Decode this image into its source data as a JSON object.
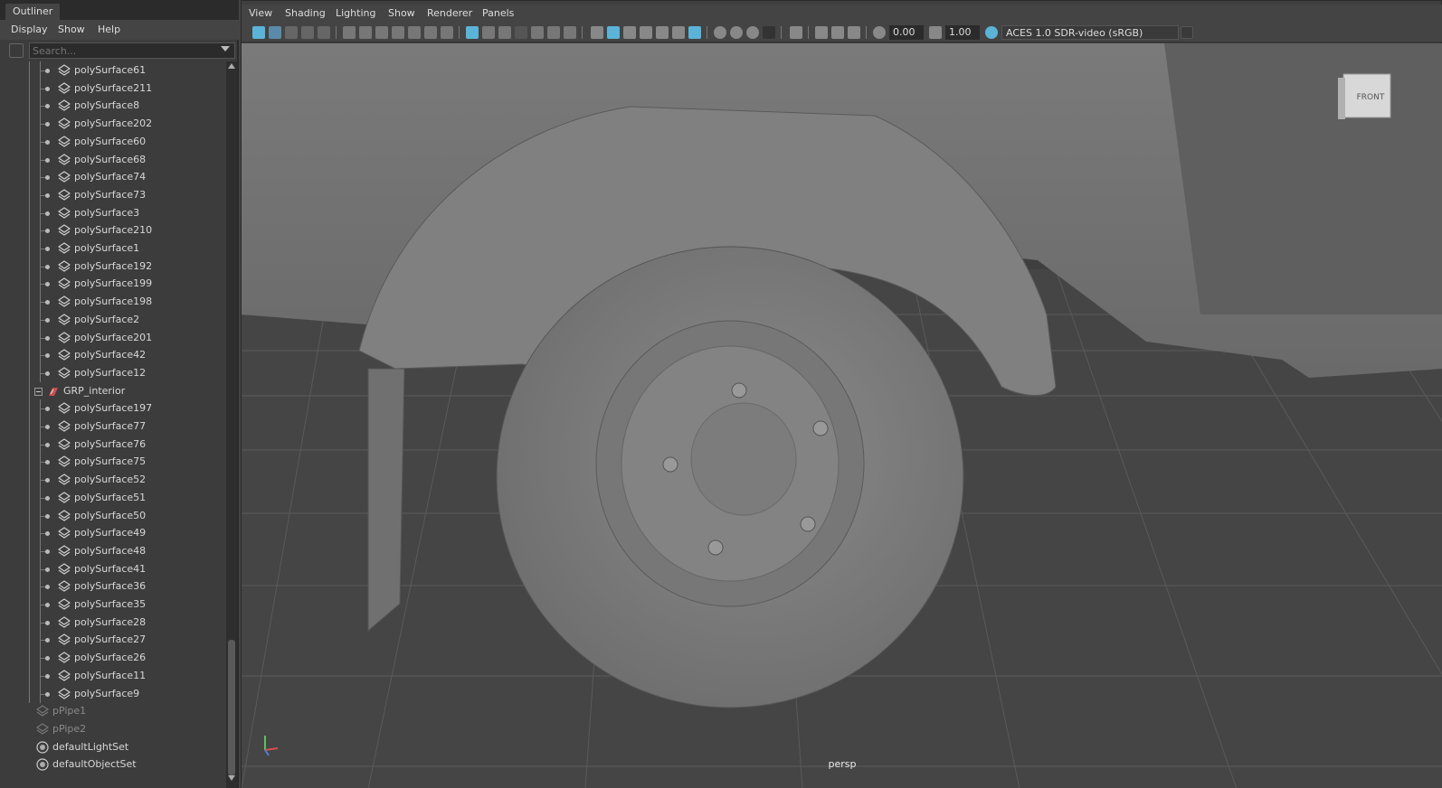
{
  "outliner": {
    "tab_title": "Outliner",
    "menu": [
      "Display",
      "Show",
      "Help"
    ],
    "search_placeholder": "Search...",
    "items": [
      {
        "label": "polySurface61",
        "type": "mesh",
        "level": 2
      },
      {
        "label": "polySurface211",
        "type": "mesh",
        "level": 2
      },
      {
        "label": "polySurface8",
        "type": "mesh",
        "level": 2
      },
      {
        "label": "polySurface202",
        "type": "mesh",
        "level": 2
      },
      {
        "label": "polySurface60",
        "type": "mesh",
        "level": 2
      },
      {
        "label": "polySurface68",
        "type": "mesh",
        "level": 2
      },
      {
        "label": "polySurface74",
        "type": "mesh",
        "level": 2
      },
      {
        "label": "polySurface73",
        "type": "mesh",
        "level": 2
      },
      {
        "label": "polySurface3",
        "type": "mesh",
        "level": 2
      },
      {
        "label": "polySurface210",
        "type": "mesh",
        "level": 2
      },
      {
        "label": "polySurface1",
        "type": "mesh",
        "level": 2
      },
      {
        "label": "polySurface192",
        "type": "mesh",
        "level": 2
      },
      {
        "label": "polySurface199",
        "type": "mesh",
        "level": 2
      },
      {
        "label": "polySurface198",
        "type": "mesh",
        "level": 2
      },
      {
        "label": "polySurface2",
        "type": "mesh",
        "level": 2
      },
      {
        "label": "polySurface201",
        "type": "mesh",
        "level": 2
      },
      {
        "label": "polySurface42",
        "type": "mesh",
        "level": 2
      },
      {
        "label": "polySurface12",
        "type": "mesh",
        "level": 2
      },
      {
        "label": "GRP_interior",
        "type": "group",
        "level": 1
      },
      {
        "label": "polySurface197",
        "type": "mesh",
        "level": 2
      },
      {
        "label": "polySurface77",
        "type": "mesh",
        "level": 2
      },
      {
        "label": "polySurface76",
        "type": "mesh",
        "level": 2
      },
      {
        "label": "polySurface75",
        "type": "mesh",
        "level": 2
      },
      {
        "label": "polySurface52",
        "type": "mesh",
        "level": 2
      },
      {
        "label": "polySurface51",
        "type": "mesh",
        "level": 2
      },
      {
        "label": "polySurface50",
        "type": "mesh",
        "level": 2
      },
      {
        "label": "polySurface49",
        "type": "mesh",
        "level": 2
      },
      {
        "label": "polySurface48",
        "type": "mesh",
        "level": 2
      },
      {
        "label": "polySurface41",
        "type": "mesh",
        "level": 2
      },
      {
        "label": "polySurface36",
        "type": "mesh",
        "level": 2
      },
      {
        "label": "polySurface35",
        "type": "mesh",
        "level": 2
      },
      {
        "label": "polySurface28",
        "type": "mesh",
        "level": 2
      },
      {
        "label": "polySurface27",
        "type": "mesh",
        "level": 2
      },
      {
        "label": "polySurface26",
        "type": "mesh",
        "level": 2
      },
      {
        "label": "polySurface11",
        "type": "mesh",
        "level": 2
      },
      {
        "label": "polySurface9",
        "type": "mesh",
        "level": 2
      },
      {
        "label": "pPipe1",
        "type": "mesh-hidden",
        "level": 0
      },
      {
        "label": "pPipe2",
        "type": "mesh-hidden",
        "level": 0
      },
      {
        "label": "defaultLightSet",
        "type": "set",
        "level": 0
      },
      {
        "label": "defaultObjectSet",
        "type": "set",
        "level": 0
      }
    ]
  },
  "viewport": {
    "menu": [
      "View",
      "Shading",
      "Lighting",
      "Show",
      "Renderer",
      "Panels"
    ],
    "exposure": "0.00",
    "gamma": "1.00",
    "color_space": "ACES 1.0 SDR-video (sRGB)",
    "camera": "persp",
    "viewcube_face": "FRONT",
    "accent_color": "#5bb4d8"
  }
}
